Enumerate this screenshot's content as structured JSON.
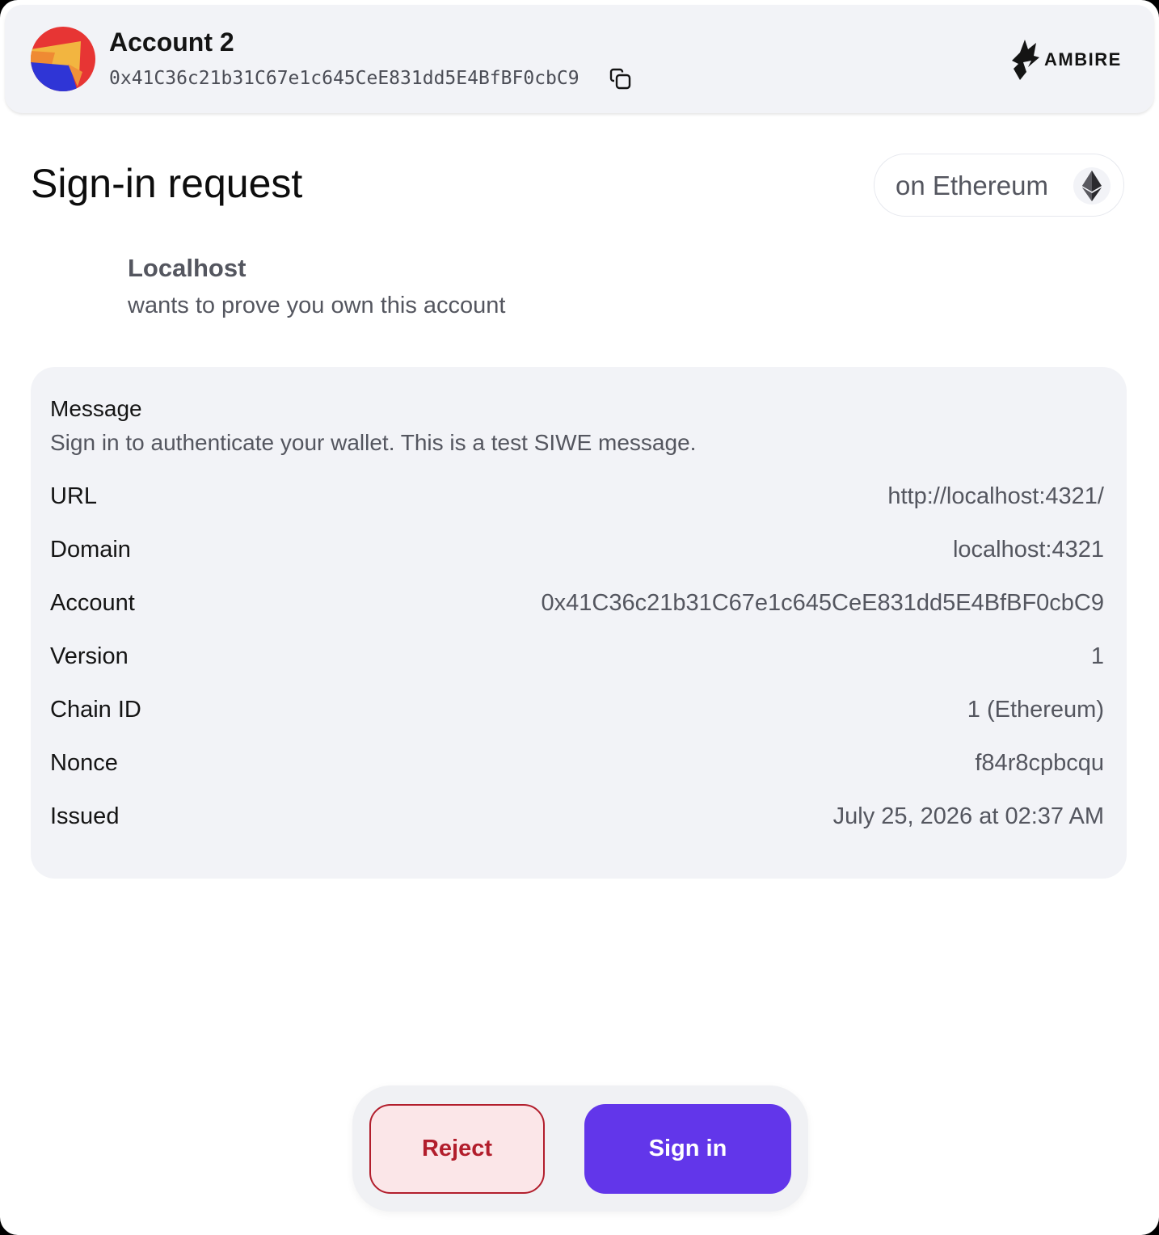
{
  "header": {
    "account_name": "Account 2",
    "account_address": "0x41C36c21b31C67e1c645CeE831dd5E4BfBF0cbC9",
    "brand": "AMBIRE"
  },
  "request": {
    "title": "Sign-in request",
    "network_label": "on Ethereum",
    "origin_name": "Localhost",
    "origin_description": "wants to prove you own this account"
  },
  "message_card": {
    "title": "Message",
    "body": "Sign in to authenticate your wallet. This is a test SIWE message.",
    "rows": [
      {
        "label": "URL",
        "value": "http://localhost:4321/"
      },
      {
        "label": "Domain",
        "value": "localhost:4321"
      },
      {
        "label": "Account",
        "value": "0x41C36c21b31C67e1c645CeE831dd5E4BfBF0cbC9"
      },
      {
        "label": "Version",
        "value": "1"
      },
      {
        "label": "Chain ID",
        "value": "1 (Ethereum)"
      },
      {
        "label": "Nonce",
        "value": "f84r8cpbcqu"
      },
      {
        "label": "Issued",
        "value": "July 25, 2026 at 02:37 AM"
      }
    ]
  },
  "actions": {
    "reject_label": "Reject",
    "sign_label": "Sign in"
  },
  "icons": {
    "copy": "copy-icon",
    "network": "ethereum-icon",
    "brand": "ambire-logo-icon"
  },
  "colors": {
    "primary": "#6236ea",
    "danger": "#b21e2c",
    "danger_bg": "#fbe6e8",
    "surface": "#f2f3f7"
  }
}
